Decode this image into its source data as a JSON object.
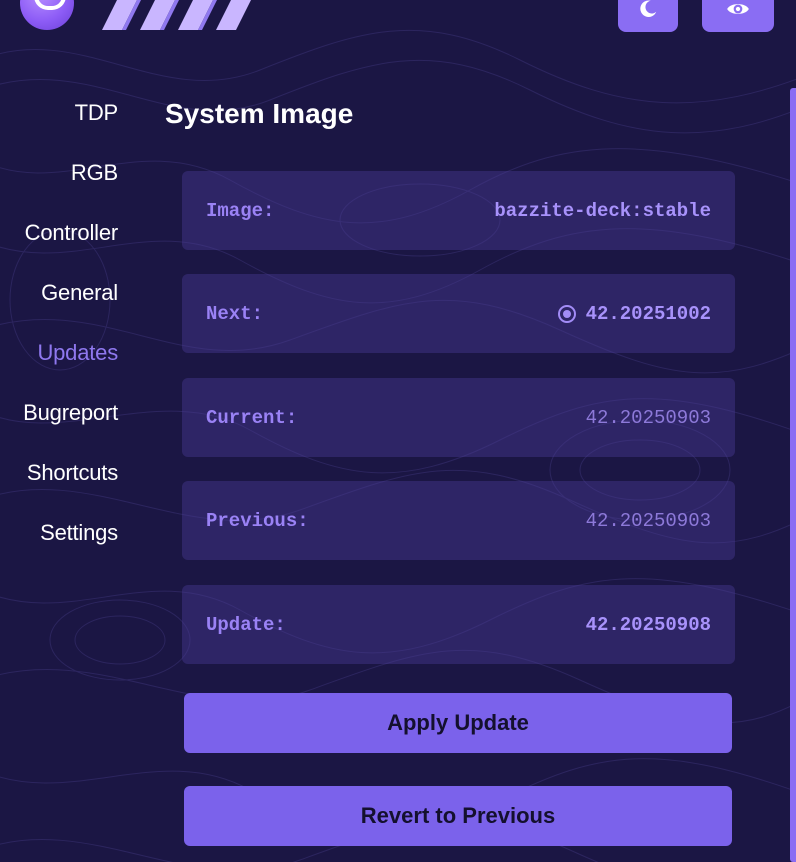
{
  "header": {
    "moon_icon": "moon-icon",
    "eye_icon": "eye-icon",
    "accent": "#8a6df3"
  },
  "sidebar": {
    "items": [
      {
        "label": "TDP"
      },
      {
        "label": "RGB"
      },
      {
        "label": "Controller"
      },
      {
        "label": "General"
      },
      {
        "label": "Updates",
        "active": true
      },
      {
        "label": "Bugreport"
      },
      {
        "label": "Shortcuts"
      },
      {
        "label": "Settings"
      }
    ]
  },
  "main": {
    "title": "System Image",
    "rows": [
      {
        "label": "Image:",
        "value": "bazzite-deck:stable"
      },
      {
        "label": "Next:",
        "value": "42.20251002",
        "selected": true
      },
      {
        "label": "Current:",
        "value": "42.20250903"
      },
      {
        "label": "Previous:",
        "value": "42.20250903"
      },
      {
        "label": "Update:",
        "value": "42.20250908"
      }
    ],
    "apply_label": "Apply Update",
    "revert_label": "Revert to Previous"
  },
  "colors": {
    "background": "#1b1644",
    "card": "#3a2f7a",
    "active_nav": "#8f78ef",
    "button": "#7b62eb"
  }
}
